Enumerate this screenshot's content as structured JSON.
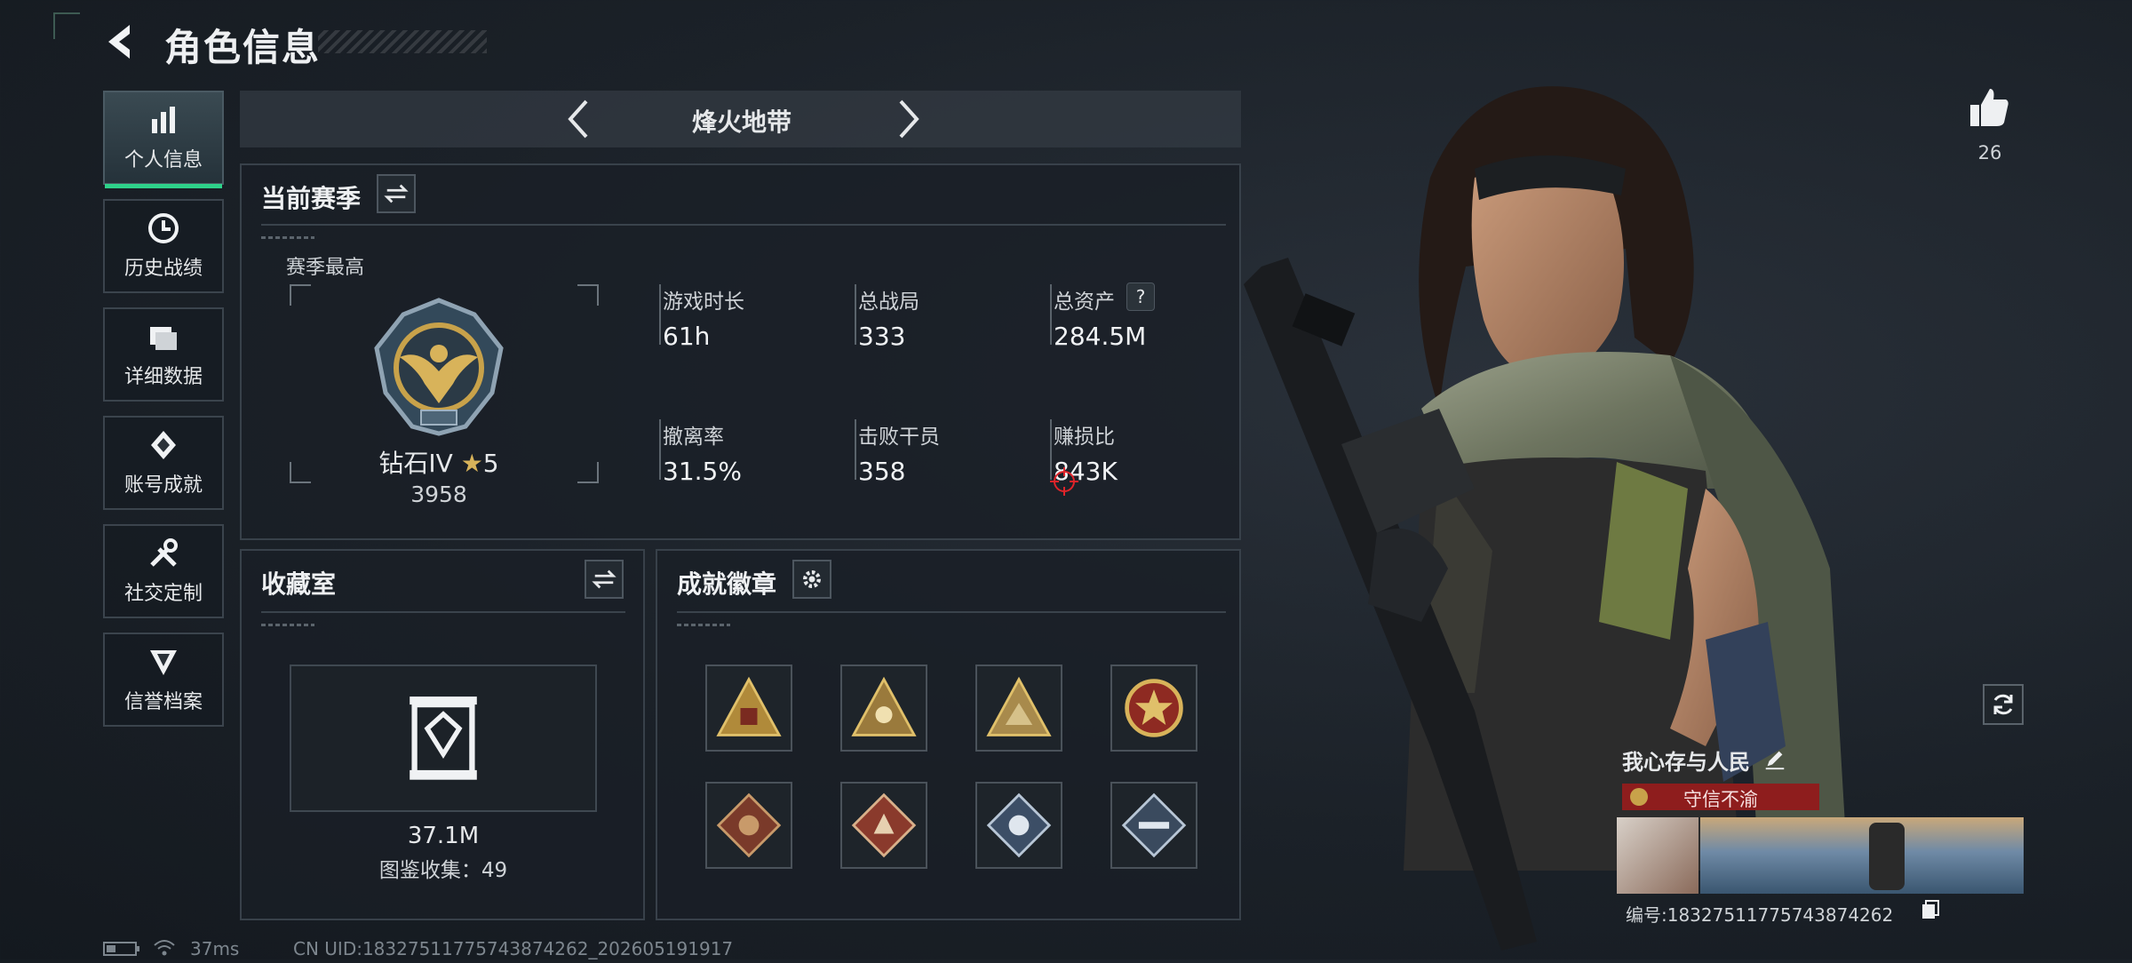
{
  "header": {
    "title": "角色信息"
  },
  "sidebar": {
    "items": [
      {
        "label": "个人信息",
        "icon": "bar-chart-icon",
        "active": true
      },
      {
        "label": "历史战绩",
        "icon": "clock-icon"
      },
      {
        "label": "详细数据",
        "icon": "folder-icon"
      },
      {
        "label": "账号成就",
        "icon": "achievement-icon"
      },
      {
        "label": "社交定制",
        "icon": "wrench-icon"
      },
      {
        "label": "信誉档案",
        "icon": "shield-icon"
      }
    ]
  },
  "mode": {
    "title": "烽火地带"
  },
  "season": {
    "title": "当前赛季",
    "best_label": "赛季最高",
    "rank_name": "钻石IV",
    "rank_stars": "5",
    "rank_points": "3958",
    "stats": [
      {
        "label": "游戏时长",
        "value": "61h"
      },
      {
        "label": "总战局",
        "value": "333"
      },
      {
        "label": "总资产",
        "value": "284.5M",
        "help": "?"
      },
      {
        "label": "撤离率",
        "value": "31.5%"
      },
      {
        "label": "击败干员",
        "value": "358"
      },
      {
        "label": "赚损比",
        "value": "843K"
      }
    ]
  },
  "collection": {
    "title": "收藏室",
    "value": "37.1M",
    "count_text": "图鉴收集：49"
  },
  "achievements": {
    "title": "成就徽章"
  },
  "likes": {
    "count": "26"
  },
  "profile": {
    "name": "我心存与人民",
    "tag": "守信不渝",
    "id_text": "编号:18327511775743874262"
  },
  "footer": {
    "ping": "37ms",
    "uid": "CN UID:18327511775743874262_202605191917"
  },
  "colors": {
    "accent": "#2ed18a",
    "tag_red": "#8e1d1d",
    "badge_gold": "#c8a24a"
  }
}
